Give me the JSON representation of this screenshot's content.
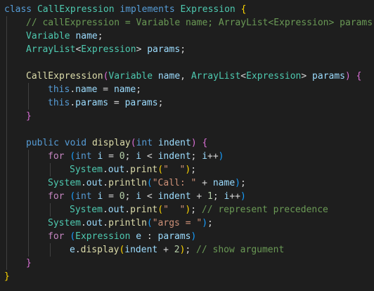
{
  "editor": {
    "colors": {
      "background": "#1e1e1e",
      "keyword": "#569cd6",
      "control": "#c586c0",
      "type": "#4ec9b0",
      "variable": "#9cdcfe",
      "function": "#dcdcaa",
      "string": "#ce9178",
      "number": "#b5cea8",
      "comment": "#6a9955",
      "bracket_1": "#ffd700",
      "bracket_2": "#da70d6",
      "bracket_3": "#179fff"
    },
    "lines": [
      {
        "indent": 0,
        "tokens": [
          {
            "t": "class ",
            "c": "kw"
          },
          {
            "t": "CallExpression ",
            "c": "ty"
          },
          {
            "t": "implements ",
            "c": "kw"
          },
          {
            "t": "Expression ",
            "c": "ty"
          },
          {
            "t": "{",
            "c": "b1"
          }
        ]
      },
      {
        "indent": 1,
        "tokens": [
          {
            "t": "// callExpression = Variable name; ArrayList<Expression> params",
            "c": "cm"
          }
        ]
      },
      {
        "indent": 1,
        "tokens": [
          {
            "t": "Variable ",
            "c": "ty"
          },
          {
            "t": "name",
            "c": "vr"
          },
          {
            "t": ";",
            "c": "pl"
          }
        ]
      },
      {
        "indent": 1,
        "tokens": [
          {
            "t": "ArrayList",
            "c": "ty"
          },
          {
            "t": "<",
            "c": "pl"
          },
          {
            "t": "Expression",
            "c": "ty"
          },
          {
            "t": "> ",
            "c": "pl"
          },
          {
            "t": "params",
            "c": "vr"
          },
          {
            "t": ";",
            "c": "pl"
          }
        ]
      },
      {
        "indent": 1,
        "tokens": []
      },
      {
        "indent": 1,
        "tokens": [
          {
            "t": "CallExpression",
            "c": "fn"
          },
          {
            "t": "(",
            "c": "b2"
          },
          {
            "t": "Variable ",
            "c": "ty"
          },
          {
            "t": "name",
            "c": "vr"
          },
          {
            "t": ", ",
            "c": "pl"
          },
          {
            "t": "ArrayList",
            "c": "ty"
          },
          {
            "t": "<",
            "c": "pl"
          },
          {
            "t": "Expression",
            "c": "ty"
          },
          {
            "t": "> ",
            "c": "pl"
          },
          {
            "t": "params",
            "c": "vr"
          },
          {
            "t": ")",
            "c": "b2"
          },
          {
            "t": " ",
            "c": "pl"
          },
          {
            "t": "{",
            "c": "b2"
          }
        ]
      },
      {
        "indent": 2,
        "tokens": [
          {
            "t": "this",
            "c": "kw"
          },
          {
            "t": ".",
            "c": "pl"
          },
          {
            "t": "name",
            "c": "vr"
          },
          {
            "t": " = ",
            "c": "pl"
          },
          {
            "t": "name",
            "c": "vr"
          },
          {
            "t": ";",
            "c": "pl"
          }
        ]
      },
      {
        "indent": 2,
        "tokens": [
          {
            "t": "this",
            "c": "kw"
          },
          {
            "t": ".",
            "c": "pl"
          },
          {
            "t": "params",
            "c": "vr"
          },
          {
            "t": " = ",
            "c": "pl"
          },
          {
            "t": "params",
            "c": "vr"
          },
          {
            "t": ";",
            "c": "pl"
          }
        ]
      },
      {
        "indent": 1,
        "tokens": [
          {
            "t": "}",
            "c": "b2"
          }
        ]
      },
      {
        "indent": 1,
        "tokens": []
      },
      {
        "indent": 1,
        "tokens": [
          {
            "t": "public ",
            "c": "kw"
          },
          {
            "t": "void ",
            "c": "kw"
          },
          {
            "t": "display",
            "c": "fn"
          },
          {
            "t": "(",
            "c": "b2"
          },
          {
            "t": "int ",
            "c": "kw"
          },
          {
            "t": "indent",
            "c": "vr"
          },
          {
            "t": ")",
            "c": "b2"
          },
          {
            "t": " ",
            "c": "pl"
          },
          {
            "t": "{",
            "c": "b2"
          }
        ]
      },
      {
        "indent": 2,
        "tokens": [
          {
            "t": "for ",
            "c": "ctl"
          },
          {
            "t": "(",
            "c": "b3"
          },
          {
            "t": "int ",
            "c": "kw"
          },
          {
            "t": "i",
            "c": "vr"
          },
          {
            "t": " = ",
            "c": "pl"
          },
          {
            "t": "0",
            "c": "nu"
          },
          {
            "t": "; ",
            "c": "pl"
          },
          {
            "t": "i",
            "c": "vr"
          },
          {
            "t": " < ",
            "c": "pl"
          },
          {
            "t": "indent",
            "c": "vr"
          },
          {
            "t": "; ",
            "c": "pl"
          },
          {
            "t": "i",
            "c": "vr"
          },
          {
            "t": "++",
            "c": "pl"
          },
          {
            "t": ")",
            "c": "b3"
          }
        ]
      },
      {
        "indent": 3,
        "tokens": [
          {
            "t": "System",
            "c": "ty"
          },
          {
            "t": ".",
            "c": "pl"
          },
          {
            "t": "out",
            "c": "vr"
          },
          {
            "t": ".",
            "c": "pl"
          },
          {
            "t": "print",
            "c": "fn"
          },
          {
            "t": "(",
            "c": "b1"
          },
          {
            "t": "\"  \"",
            "c": "st"
          },
          {
            "t": ")",
            "c": "b1"
          },
          {
            "t": ";",
            "c": "pl"
          }
        ]
      },
      {
        "indent": 2,
        "tokens": [
          {
            "t": "System",
            "c": "ty"
          },
          {
            "t": ".",
            "c": "pl"
          },
          {
            "t": "out",
            "c": "vr"
          },
          {
            "t": ".",
            "c": "pl"
          },
          {
            "t": "println",
            "c": "fn"
          },
          {
            "t": "(",
            "c": "b3"
          },
          {
            "t": "\"Call: \"",
            "c": "st"
          },
          {
            "t": " + ",
            "c": "pl"
          },
          {
            "t": "name",
            "c": "vr"
          },
          {
            "t": ")",
            "c": "b3"
          },
          {
            "t": ";",
            "c": "pl"
          }
        ]
      },
      {
        "indent": 2,
        "tokens": [
          {
            "t": "for ",
            "c": "ctl"
          },
          {
            "t": "(",
            "c": "b3"
          },
          {
            "t": "int ",
            "c": "kw"
          },
          {
            "t": "i",
            "c": "vr"
          },
          {
            "t": " = ",
            "c": "pl"
          },
          {
            "t": "0",
            "c": "nu"
          },
          {
            "t": "; ",
            "c": "pl"
          },
          {
            "t": "i",
            "c": "vr"
          },
          {
            "t": " < ",
            "c": "pl"
          },
          {
            "t": "indent",
            "c": "vr"
          },
          {
            "t": " + ",
            "c": "pl"
          },
          {
            "t": "1",
            "c": "nu"
          },
          {
            "t": "; ",
            "c": "pl"
          },
          {
            "t": "i",
            "c": "vr"
          },
          {
            "t": "++",
            "c": "pl"
          },
          {
            "t": ")",
            "c": "b3"
          }
        ]
      },
      {
        "indent": 3,
        "tokens": [
          {
            "t": "System",
            "c": "ty"
          },
          {
            "t": ".",
            "c": "pl"
          },
          {
            "t": "out",
            "c": "vr"
          },
          {
            "t": ".",
            "c": "pl"
          },
          {
            "t": "print",
            "c": "fn"
          },
          {
            "t": "(",
            "c": "b1"
          },
          {
            "t": "\"  \"",
            "c": "st"
          },
          {
            "t": ")",
            "c": "b1"
          },
          {
            "t": "; ",
            "c": "pl"
          },
          {
            "t": "// represent precedence",
            "c": "cm"
          }
        ]
      },
      {
        "indent": 2,
        "tokens": [
          {
            "t": "System",
            "c": "ty"
          },
          {
            "t": ".",
            "c": "pl"
          },
          {
            "t": "out",
            "c": "vr"
          },
          {
            "t": ".",
            "c": "pl"
          },
          {
            "t": "println",
            "c": "fn"
          },
          {
            "t": "(",
            "c": "b3"
          },
          {
            "t": "\"args = \"",
            "c": "st"
          },
          {
            "t": ")",
            "c": "b3"
          },
          {
            "t": ";",
            "c": "pl"
          }
        ]
      },
      {
        "indent": 2,
        "tokens": [
          {
            "t": "for ",
            "c": "ctl"
          },
          {
            "t": "(",
            "c": "b3"
          },
          {
            "t": "Expression ",
            "c": "ty"
          },
          {
            "t": "e",
            "c": "vr"
          },
          {
            "t": " : ",
            "c": "pl"
          },
          {
            "t": "params",
            "c": "vr"
          },
          {
            "t": ")",
            "c": "b3"
          }
        ]
      },
      {
        "indent": 3,
        "tokens": [
          {
            "t": "e",
            "c": "vr"
          },
          {
            "t": ".",
            "c": "pl"
          },
          {
            "t": "display",
            "c": "fn"
          },
          {
            "t": "(",
            "c": "b1"
          },
          {
            "t": "indent",
            "c": "vr"
          },
          {
            "t": " + ",
            "c": "pl"
          },
          {
            "t": "2",
            "c": "nu"
          },
          {
            "t": ")",
            "c": "b1"
          },
          {
            "t": "; ",
            "c": "pl"
          },
          {
            "t": "// show argument",
            "c": "cm"
          }
        ]
      },
      {
        "indent": 1,
        "tokens": [
          {
            "t": "}",
            "c": "b2"
          }
        ]
      },
      {
        "indent": 0,
        "tokens": [
          {
            "t": "}",
            "c": "b1"
          }
        ]
      }
    ]
  }
}
